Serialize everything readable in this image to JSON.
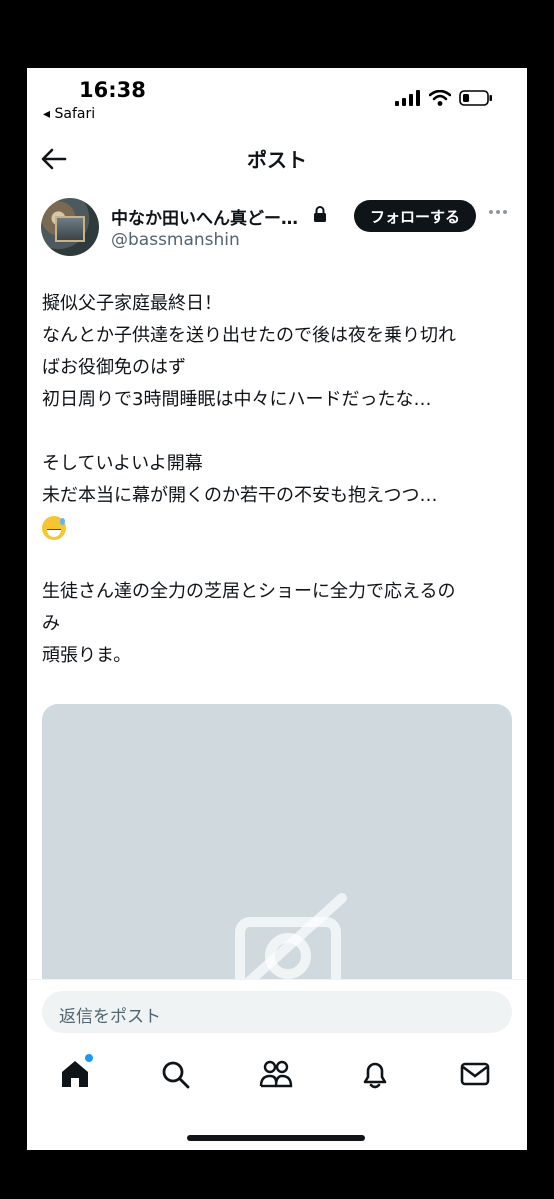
{
  "status_bar": {
    "time": "16:38",
    "back_app": "◂ Safari",
    "icons": [
      "signal-icon",
      "wifi-icon",
      "battery-icon"
    ]
  },
  "nav": {
    "title": "ポスト",
    "back_icon": "arrow-left-icon"
  },
  "author": {
    "display_name": "中なか田いへん真どー…",
    "handle": "@bassmanshin",
    "protected_icon": "lock-icon",
    "follow_label": "フォローする",
    "more_icon": "more-horizontal-icon"
  },
  "post": {
    "lines": [
      "擬似父子家庭最終日！",
      "なんとか子供達を送り出せたので後は夜を乗り切れ",
      "ばお役御免のはず",
      "初日周りで3時間睡眠は中々にハードだったな…",
      "",
      "そしていよいよ開幕",
      "未だ本当に幕が開くのか若干の不安も抱えつつ…",
      "😅",
      "",
      "生徒さん達の全力の芝居とショーに全力で応えるの",
      "み",
      "頑張りま。"
    ],
    "media_icon": "image-unavailable-icon"
  },
  "reply": {
    "placeholder": "返信をポスト"
  },
  "tabbar": {
    "items": [
      "home-icon",
      "search-icon",
      "communities-icon",
      "notifications-icon",
      "messages-icon"
    ],
    "accent": "#1d9bf0"
  },
  "colors": {
    "text": "#0f1419",
    "secondary": "#536471",
    "media_placeholder": "#cfd9de"
  }
}
